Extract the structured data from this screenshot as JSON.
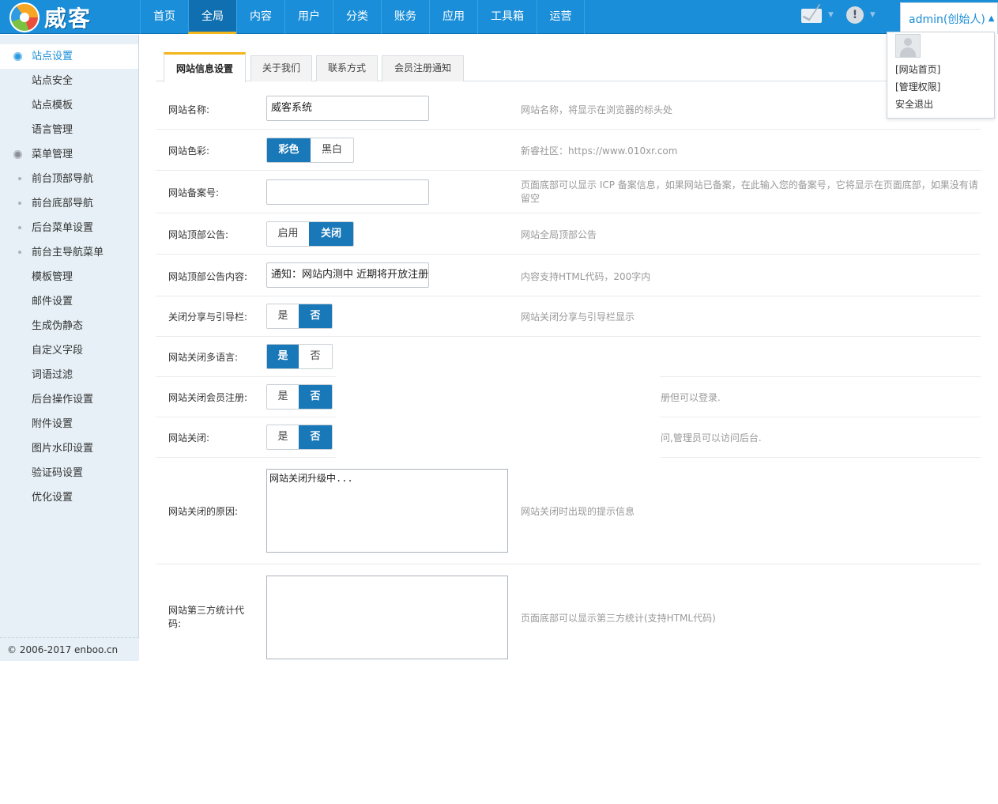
{
  "brand": {
    "name": "威客"
  },
  "nav": {
    "items": [
      "首页",
      "全局",
      "内容",
      "用户",
      "分类",
      "账务",
      "应用",
      "工具箱",
      "运营"
    ],
    "active": "全局"
  },
  "user": {
    "name": "admin(创始人)",
    "menu": [
      "[网站首页]",
      "[管理权限]",
      "安全退出"
    ]
  },
  "sidebar": {
    "items": [
      {
        "label": "站点设置",
        "kind": "active"
      },
      {
        "label": "站点安全",
        "kind": "plain"
      },
      {
        "label": "站点模板",
        "kind": "plain"
      },
      {
        "label": "语言管理",
        "kind": "plain"
      },
      {
        "label": "菜单管理",
        "kind": "section"
      },
      {
        "label": "前台顶部导航",
        "kind": "sub"
      },
      {
        "label": "前台底部导航",
        "kind": "sub"
      },
      {
        "label": "后台菜单设置",
        "kind": "sub"
      },
      {
        "label": "前台主导航菜单",
        "kind": "sub"
      },
      {
        "label": "模板管理",
        "kind": "plain"
      },
      {
        "label": "邮件设置",
        "kind": "plain"
      },
      {
        "label": "生成伪静态",
        "kind": "plain"
      },
      {
        "label": "自定义字段",
        "kind": "plain"
      },
      {
        "label": "词语过滤",
        "kind": "plain"
      },
      {
        "label": "后台操作设置",
        "kind": "plain"
      },
      {
        "label": "附件设置",
        "kind": "plain"
      },
      {
        "label": "图片水印设置",
        "kind": "plain"
      },
      {
        "label": "验证码设置",
        "kind": "plain"
      },
      {
        "label": "优化设置",
        "kind": "plain"
      }
    ],
    "copyright": "© 2006-2017 enboo.cn"
  },
  "tabs": [
    "网站信息设置",
    "关于我们",
    "联系方式",
    "会员注册通知"
  ],
  "form": {
    "site_name": {
      "label": "网站名称:",
      "value": "威客系统",
      "desc": "网站名称，将显示在浏览器的标头处"
    },
    "site_color": {
      "label": "网站色彩:",
      "options": [
        "彩色",
        "黑白"
      ],
      "selected": "彩色",
      "desc": "新睿社区：https://www.010xr.com"
    },
    "icp": {
      "label": "网站备案号:",
      "value": "",
      "desc": "页面底部可以显示 ICP 备案信息，如果网站已备案，在此输入您的备案号，它将显示在页面底部，如果没有请留空"
    },
    "notice": {
      "label": "网站顶部公告:",
      "options": [
        "启用",
        "关闭"
      ],
      "selected": "关闭",
      "desc": "网站全局顶部公告"
    },
    "notice_content": {
      "label": "网站顶部公告内容:",
      "value": "通知：网站内测中 近期将开放注册",
      "desc": "内容支持HTML代码，200字内"
    },
    "close_share": {
      "label": "关闭分享与引导栏:",
      "options": [
        "是",
        "否"
      ],
      "selected": "否",
      "desc": "网站关闭分享与引导栏显示"
    },
    "close_lang": {
      "label": "网站关闭多语言:",
      "options": [
        "是",
        "否"
      ],
      "selected": "是",
      "desc": ""
    },
    "close_register": {
      "label": "网站关闭会员注册:",
      "options": [
        "是",
        "否"
      ],
      "selected": "否",
      "desc": "册但可以登录."
    },
    "close_site": {
      "label": "网站关闭:",
      "options": [
        "是",
        "否"
      ],
      "selected": "否",
      "desc": "问,管理员可以访问后台."
    },
    "close_reason": {
      "label": "网站关闭的原因:",
      "value": "网站关闭升级中...",
      "desc": "网站关闭时出现的提示信息"
    },
    "stats_code": {
      "label": "网站第三方统计代码:",
      "value": "",
      "desc": "页面底部可以显示第三方统计(支持HTML代码)"
    }
  },
  "colors": {
    "topbar": "#1a8ed8",
    "accent": "#f2b51a",
    "selected_toggle": "#1878b8",
    "sidebar_bg": "#e6f0f6"
  }
}
